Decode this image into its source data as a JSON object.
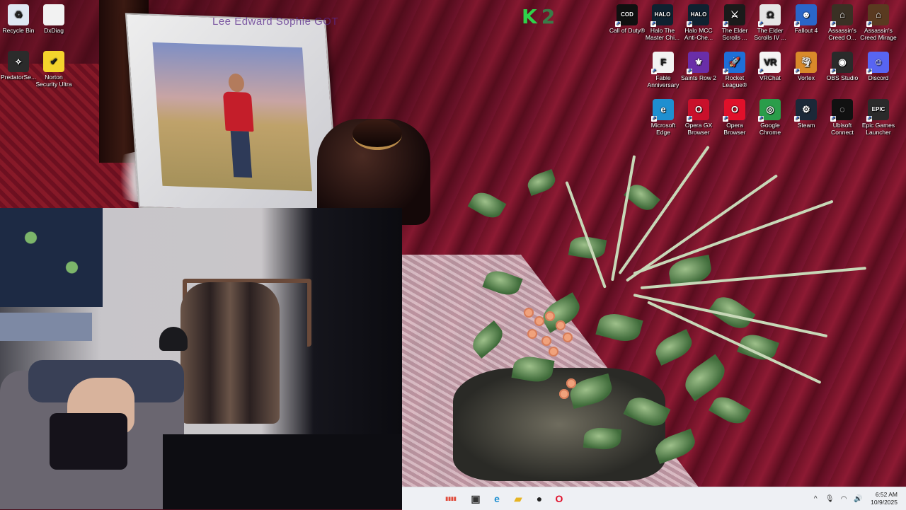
{
  "overlay": {
    "watermark_text": "Lee Edward Sophie GOT",
    "k2_letter": "K",
    "k2_number": "2"
  },
  "desktop_icons": [
    {
      "label": "Recycle Bin",
      "icon": "recycle-bin-icon",
      "glyph": "♻",
      "color": "#dfe7f3"
    },
    {
      "label": "DxDiag",
      "icon": "document-icon",
      "glyph": "",
      "color": "#f2f2f2"
    },
    {
      "label": "PredatorSe...",
      "icon": "predator-icon",
      "glyph": "⟡",
      "color": "#2b2b2b"
    },
    {
      "label": "Norton Security Ultra",
      "icon": "norton-icon",
      "glyph": "✔",
      "color": "#f4d32c"
    },
    {
      "label": "Call of Duty®",
      "icon": "call-of-duty-icon",
      "glyph": "COD",
      "color": "#101010"
    },
    {
      "label": "Halo The Master Chi...",
      "icon": "halo-icon",
      "glyph": "HALO",
      "color": "#0f2130"
    },
    {
      "label": "Halo MCC Anti-Che...",
      "icon": "halo-mcc-icon",
      "glyph": "HALO",
      "color": "#0f2130"
    },
    {
      "label": "The Elder Scrolls ...",
      "icon": "elder-scrolls-icon",
      "glyph": "⚔",
      "color": "#1a1a1a"
    },
    {
      "label": "The Elder Scrolls IV ...",
      "icon": "oblivion-icon",
      "glyph": "Ω",
      "color": "#e6e6e6"
    },
    {
      "label": "Fallout 4",
      "icon": "fallout-icon",
      "glyph": "☻",
      "color": "#2a66c9"
    },
    {
      "label": "Assassin's Creed O...",
      "icon": "assassins-creed-odyssey-icon",
      "glyph": "⌂",
      "color": "#3a3024"
    },
    {
      "label": "Assassin's Creed Mirage",
      "icon": "assassins-creed-mirage-icon",
      "glyph": "⌂",
      "color": "#5a3a20"
    },
    {
      "label": "Fable Anniversary",
      "icon": "fable-icon",
      "glyph": "F",
      "color": "#f2f2f2"
    },
    {
      "label": "Saints Row 2",
      "icon": "saints-row-icon",
      "glyph": "⚜",
      "color": "#6a2ea8"
    },
    {
      "label": "Rocket League®",
      "icon": "rocket-league-icon",
      "glyph": "🚀",
      "color": "#1e6fd8"
    },
    {
      "label": "VRChat",
      "icon": "vrchat-icon",
      "glyph": "VR",
      "color": "#f4f4f4"
    },
    {
      "label": "Vortex",
      "icon": "vortex-icon",
      "glyph": "🌪",
      "color": "#d98a2a"
    },
    {
      "label": "OBS Studio",
      "icon": "obs-icon",
      "glyph": "◉",
      "color": "#2a2a2a"
    },
    {
      "label": "Discord",
      "icon": "discord-icon",
      "glyph": "☺",
      "color": "#5865f2"
    },
    {
      "label": "Microsoft Edge",
      "icon": "edge-icon",
      "glyph": "e",
      "color": "#1e8fd0"
    },
    {
      "label": "Opera GX Browser",
      "icon": "opera-gx-icon",
      "glyph": "O",
      "color": "#c9102b"
    },
    {
      "label": "Opera Browser",
      "icon": "opera-icon",
      "glyph": "O",
      "color": "#e0102a"
    },
    {
      "label": "Google Chrome",
      "icon": "chrome-icon",
      "glyph": "◎",
      "color": "#2a9d4a"
    },
    {
      "label": "Steam",
      "icon": "steam-icon",
      "glyph": "⚙",
      "color": "#1b2838"
    },
    {
      "label": "Ubisoft Connect",
      "icon": "ubisoft-icon",
      "glyph": "◌",
      "color": "#111111"
    },
    {
      "label": "Epic Games Launcher",
      "icon": "epic-games-icon",
      "glyph": "EPIC",
      "color": "#2a2a2a"
    }
  ],
  "taskbar": {
    "apps": [
      {
        "name": "widgets-icon",
        "glyph": "▮▮▮▮"
      },
      {
        "name": "app-window-icon",
        "glyph": "▣"
      },
      {
        "name": "edge-taskbar-icon",
        "glyph": "e"
      },
      {
        "name": "file-explorer-icon",
        "glyph": "▰"
      },
      {
        "name": "chat-app-icon",
        "glyph": "●"
      },
      {
        "name": "opera-taskbar-icon",
        "glyph": "O"
      }
    ],
    "tray": {
      "chevron": "^",
      "time": "6:52 AM",
      "date": "10/9/2025"
    }
  }
}
